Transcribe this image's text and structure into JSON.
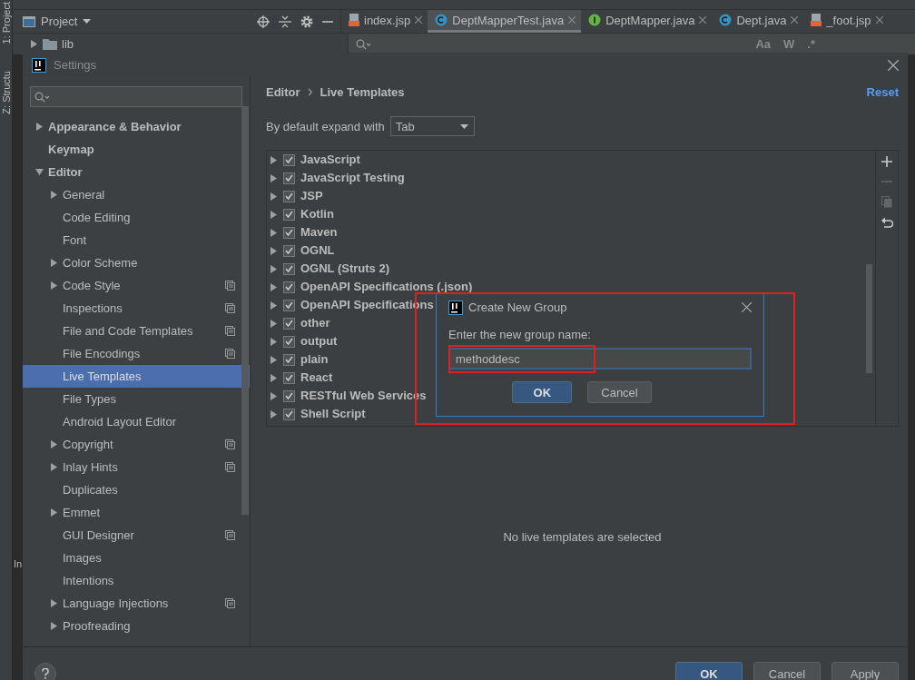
{
  "ide": {
    "side_tabs": [
      {
        "label": "1: Project"
      },
      {
        "label": "Z: Structu"
      }
    ],
    "project_panel": {
      "title": "Project",
      "tree": [
        {
          "label": "lib",
          "expanded": false
        }
      ]
    },
    "editor_tabs": [
      {
        "label": "index.jsp",
        "kind": "jsp",
        "selected": false
      },
      {
        "label": "DeptMapperTest.java",
        "kind": "class",
        "selected": true
      },
      {
        "label": "DeptMapper.java",
        "kind": "interface",
        "selected": false
      },
      {
        "label": "Dept.java",
        "kind": "class",
        "selected": false
      },
      {
        "label": "_foot.jsp",
        "kind": "jsp",
        "selected": false
      }
    ],
    "find_options": [
      "Aa",
      "W",
      ".*"
    ],
    "bottom_panel": {
      "label": "In"
    }
  },
  "settings": {
    "title": "Settings",
    "sidebar": {
      "items": [
        {
          "label": "Appearance & Behavior",
          "kind": "folder",
          "expanded": false,
          "selected": false
        },
        {
          "label": "Keymap",
          "kind": "page",
          "selected": false
        },
        {
          "label": "Editor",
          "kind": "folder",
          "expanded": true,
          "selected": false,
          "children": [
            {
              "label": "General",
              "kind": "folder",
              "expanded": false,
              "selected": false,
              "shared": false
            },
            {
              "label": "Code Editing",
              "kind": "page",
              "selected": false,
              "shared": false
            },
            {
              "label": "Font",
              "kind": "page",
              "selected": false,
              "shared": false
            },
            {
              "label": "Color Scheme",
              "kind": "folder",
              "expanded": false,
              "selected": false,
              "shared": false
            },
            {
              "label": "Code Style",
              "kind": "folder",
              "expanded": false,
              "selected": false,
              "shared": true
            },
            {
              "label": "Inspections",
              "kind": "page",
              "selected": false,
              "shared": true
            },
            {
              "label": "File and Code Templates",
              "kind": "page",
              "selected": false,
              "shared": true
            },
            {
              "label": "File Encodings",
              "kind": "page",
              "selected": false,
              "shared": true
            },
            {
              "label": "Live Templates",
              "kind": "page",
              "selected": true,
              "shared": false
            },
            {
              "label": "File Types",
              "kind": "page",
              "selected": false,
              "shared": false
            },
            {
              "label": "Android Layout Editor",
              "kind": "page",
              "selected": false,
              "shared": false
            },
            {
              "label": "Copyright",
              "kind": "folder",
              "expanded": false,
              "selected": false,
              "shared": true
            },
            {
              "label": "Inlay Hints",
              "kind": "folder",
              "expanded": false,
              "selected": false,
              "shared": true
            },
            {
              "label": "Duplicates",
              "kind": "page",
              "selected": false,
              "shared": false
            },
            {
              "label": "Emmet",
              "kind": "folder",
              "expanded": false,
              "selected": false,
              "shared": false
            },
            {
              "label": "GUI Designer",
              "kind": "page",
              "selected": false,
              "shared": true
            },
            {
              "label": "Images",
              "kind": "page",
              "selected": false,
              "shared": false
            },
            {
              "label": "Intentions",
              "kind": "page",
              "selected": false,
              "shared": false
            },
            {
              "label": "Language Injections",
              "kind": "folder",
              "expanded": false,
              "selected": false,
              "shared": true
            },
            {
              "label": "Proofreading",
              "kind": "folder",
              "expanded": false,
              "selected": false,
              "shared": false
            }
          ]
        }
      ]
    },
    "breadcrumb": [
      "Editor",
      "Live Templates"
    ],
    "reset": "Reset",
    "expand_with": {
      "label": "By default expand with",
      "value": "Tab"
    },
    "template_groups": [
      {
        "label": "JavaScript",
        "expanded": false,
        "checked": true
      },
      {
        "label": "JavaScript Testing",
        "expanded": false,
        "checked": true
      },
      {
        "label": "JSP",
        "expanded": false,
        "checked": true
      },
      {
        "label": "Kotlin",
        "expanded": false,
        "checked": true
      },
      {
        "label": "Maven",
        "expanded": false,
        "checked": true
      },
      {
        "label": "OGNL",
        "expanded": false,
        "checked": true
      },
      {
        "label": "OGNL (Struts 2)",
        "expanded": false,
        "checked": true
      },
      {
        "label": "OpenAPI Specifications (.json)",
        "expanded": false,
        "checked": true
      },
      {
        "label": "OpenAPI Specifications",
        "expanded": false,
        "checked": true
      },
      {
        "label": "other",
        "expanded": false,
        "checked": true
      },
      {
        "label": "output",
        "expanded": false,
        "checked": true
      },
      {
        "label": "plain",
        "expanded": false,
        "checked": true
      },
      {
        "label": "React",
        "expanded": false,
        "checked": true
      },
      {
        "label": "RESTful Web Services",
        "expanded": false,
        "checked": true
      },
      {
        "label": "Shell Script",
        "expanded": false,
        "checked": true
      }
    ],
    "empty_message": "No live templates are selected",
    "buttons": [
      {
        "label": "OK",
        "kind": "default"
      },
      {
        "label": "Cancel",
        "kind": "normal"
      },
      {
        "label": "Apply",
        "kind": "normal"
      }
    ]
  },
  "new_group_dialog": {
    "title": "Create New Group",
    "label": "Enter the new group name:",
    "value": "methoddesc",
    "buttons": [
      {
        "label": "OK",
        "kind": "default"
      },
      {
        "label": "Cancel",
        "kind": "normal"
      }
    ],
    "outlined": true,
    "field_outlined": true
  }
}
